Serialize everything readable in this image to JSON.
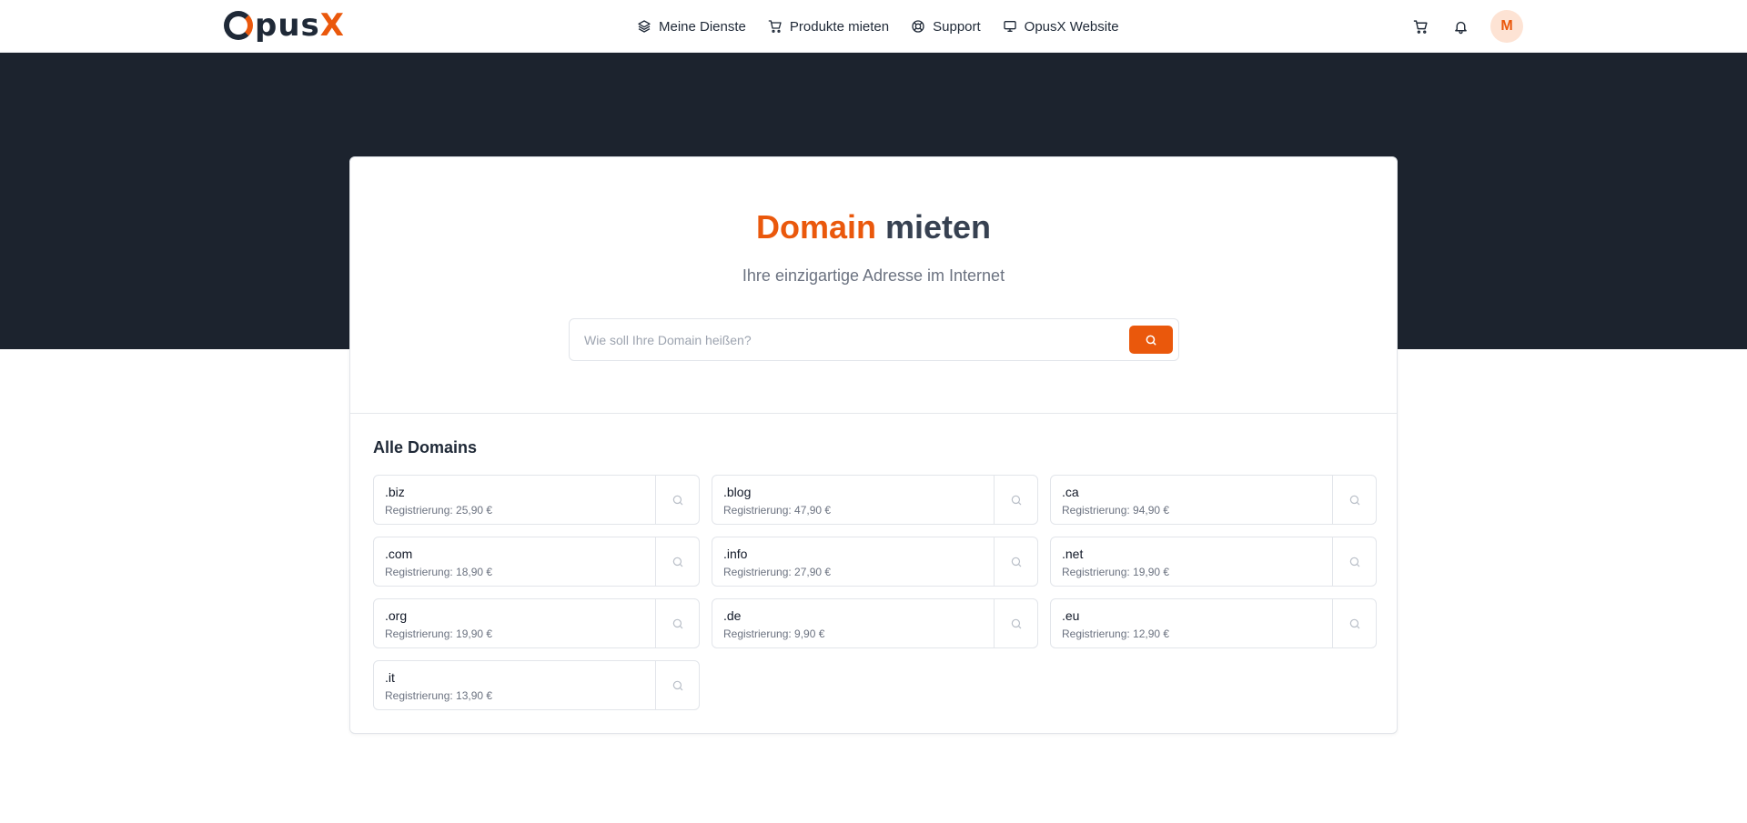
{
  "brand": {
    "logo_main": "pus",
    "logo_x": "X"
  },
  "nav": {
    "items": [
      {
        "label": "Meine Dienste",
        "icon": "layers-icon"
      },
      {
        "label": "Produkte mieten",
        "icon": "cart-icon"
      },
      {
        "label": "Support",
        "icon": "lifebuoy-icon"
      },
      {
        "label": "OpusX Website",
        "icon": "monitor-icon"
      }
    ],
    "right_icons": [
      "cart-icon",
      "bell-icon"
    ],
    "avatar_initial": "M"
  },
  "hero": {
    "title_accent": "Domain",
    "title_rest": "mieten",
    "subtitle": "Ihre einzigartige Adresse im Internet",
    "search_placeholder": "Wie soll Ihre Domain heißen?",
    "search_value": ""
  },
  "domains": {
    "title": "Alle Domains",
    "price_prefix": "Registrierung:",
    "items": [
      {
        "tld": ".biz",
        "price": "25,90 €"
      },
      {
        "tld": ".blog",
        "price": "47,90 €"
      },
      {
        "tld": ".ca",
        "price": "94,90 €"
      },
      {
        "tld": ".com",
        "price": "18,90 €"
      },
      {
        "tld": ".info",
        "price": "27,90 €"
      },
      {
        "tld": ".net",
        "price": "19,90 €"
      },
      {
        "tld": ".org",
        "price": "19,90 €"
      },
      {
        "tld": ".de",
        "price": "9,90 €"
      },
      {
        "tld": ".eu",
        "price": "12,90 €"
      },
      {
        "tld": ".it",
        "price": "13,90 €"
      }
    ]
  },
  "colors": {
    "accent": "#ea580c",
    "hero_bg": "#1c232e",
    "text_dark": "#1f2937"
  }
}
